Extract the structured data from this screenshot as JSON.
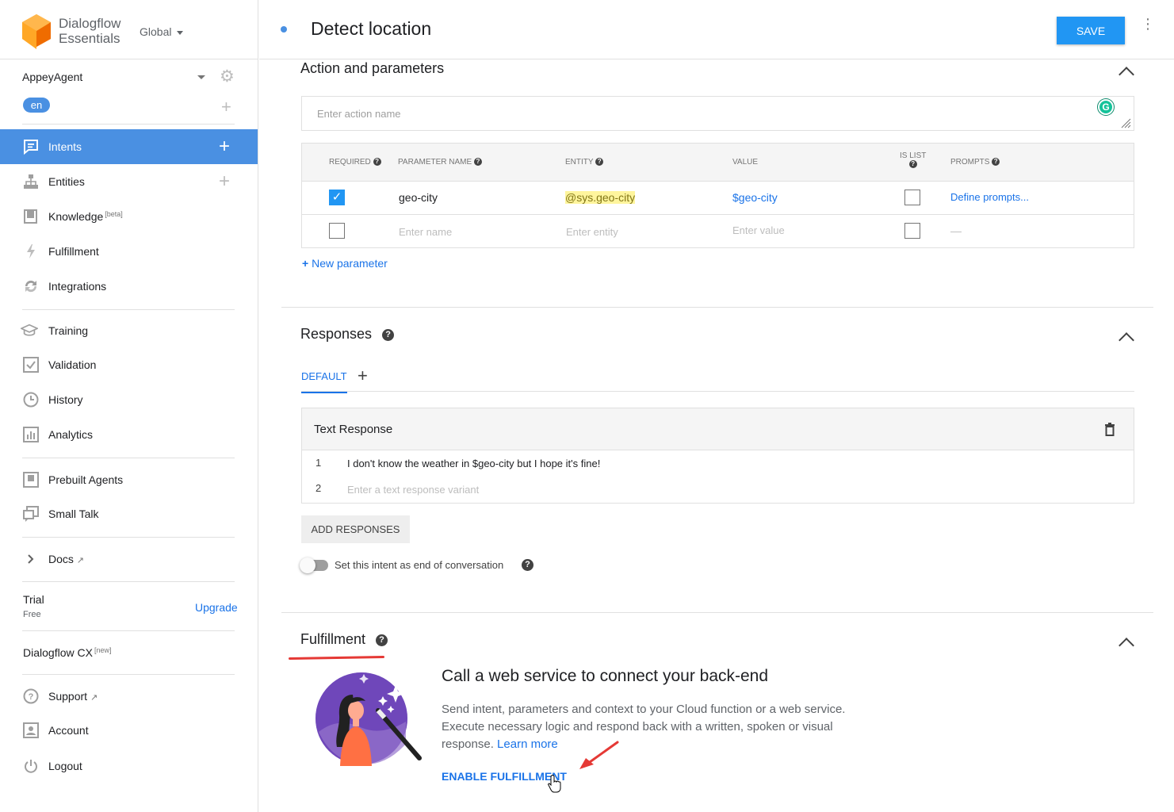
{
  "sidebar": {
    "product_line1": "Dialogflow",
    "product_line2": "Essentials",
    "region": "Global",
    "agent_name": "AppeyAgent",
    "language": "en",
    "nav": [
      {
        "label": "Intents",
        "icon": "chat-icon"
      },
      {
        "label": "Entities",
        "icon": "hierarchy-icon"
      },
      {
        "label": "Knowledge",
        "icon": "book-icon",
        "tag": "[beta]"
      },
      {
        "label": "Fulfillment",
        "icon": "bolt-icon"
      },
      {
        "label": "Integrations",
        "icon": "sync-icon"
      },
      {
        "label": "Training",
        "icon": "graduation-cap-icon"
      },
      {
        "label": "Validation",
        "icon": "check-square-icon"
      },
      {
        "label": "History",
        "icon": "clock-icon"
      },
      {
        "label": "Analytics",
        "icon": "bar-chart-icon"
      },
      {
        "label": "Prebuilt Agents",
        "icon": "agent-icon"
      },
      {
        "label": "Small Talk",
        "icon": "small-talk-icon"
      },
      {
        "label": "Docs",
        "icon": "chevron-right-icon"
      }
    ],
    "trial_label": "Trial",
    "trial_sub": "Free",
    "upgrade": "Upgrade",
    "cx_label": "Dialogflow CX",
    "cx_tag": "[new]",
    "bottom_nav": [
      {
        "label": "Support",
        "icon": "help-circle-icon"
      },
      {
        "label": "Account",
        "icon": "account-box-icon"
      },
      {
        "label": "Logout",
        "icon": "power-icon"
      }
    ]
  },
  "header": {
    "title": "Detect location",
    "save_label": "SAVE"
  },
  "action_section": {
    "title": "Action and parameters",
    "action_placeholder": "Enter action name",
    "columns": [
      "REQUIRED",
      "PARAMETER NAME",
      "ENTITY",
      "VALUE",
      "IS LIST",
      "PROMPTS"
    ],
    "rows": [
      {
        "required": true,
        "name": "geo-city",
        "entity": "@sys.geo-city",
        "value": "$geo-city",
        "is_list": false,
        "prompts": "Define prompts..."
      },
      {
        "required": false,
        "name": "Enter name",
        "entity": "Enter entity",
        "value": "Enter value",
        "is_list": false,
        "prompts": "—"
      }
    ],
    "new_parameter": "New parameter"
  },
  "responses": {
    "title": "Responses",
    "tab_default": "DEFAULT",
    "text_response_title": "Text Response",
    "lines": [
      {
        "num": "1",
        "text": "I don't know the weather in $geo-city but I hope it's fine!"
      },
      {
        "num": "2",
        "text": "Enter a text response variant"
      }
    ],
    "add_responses": "ADD RESPONSES",
    "end_conversation_label": "Set this intent as end of conversation",
    "end_conversation": false
  },
  "fulfillment": {
    "title": "Fulfillment",
    "heading": "Call a web service to connect your back-end",
    "desc": "Send intent, parameters and context to your Cloud function or a web service. Execute necessary logic and respond back with a written, spoken or visual response.",
    "learn_more": "Learn more",
    "enable": "ENABLE FULFILLMENT"
  },
  "colors": {
    "accent": "#4a90e2",
    "save": "#2196f3",
    "link": "#1a73e8",
    "annotation": "#e53935"
  }
}
